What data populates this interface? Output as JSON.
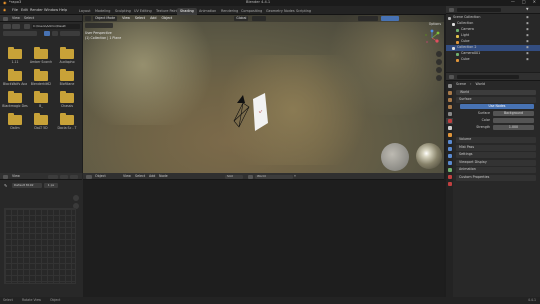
{
  "window": {
    "title": "Blender 4.4.1",
    "app_label": "*rapo3",
    "controls": [
      "—",
      "□",
      "✕"
    ]
  },
  "menu": [
    "File",
    "Edit",
    "Render",
    "Window",
    "Help"
  ],
  "workspaces": [
    "Layout",
    "Modeling",
    "Sculpting",
    "UV Editing",
    "Texture Paint",
    "Shading",
    "Animation",
    "Rendering",
    "Compositing",
    "Geometry Nodes",
    "Scripting"
  ],
  "active_workspace": "Shading",
  "file_browser": {
    "header": [
      "View",
      "Select"
    ],
    "path": "C:\\Users\\Admin\\Deskt",
    "folders": [
      "1.11",
      "Amber Scorch",
      "Audiopho",
      "BlackWolfs Ava",
      "Blenderkit62",
      "Blofiliane",
      "Blackmagic Des",
      "B_",
      "Chassis",
      "Dalim",
      "DaLT 5D",
      "Dacia Sc - T"
    ]
  },
  "viewport": {
    "mode": "Object Mode",
    "menus": [
      "View",
      "Select",
      "Add",
      "Object"
    ],
    "shading": "Global",
    "info_line1": "User Perspective",
    "info_line2": "(1) Collection | 1 Plane",
    "options": "Options"
  },
  "shader_editor": {
    "header_left": [
      "Object",
      "View",
      "Select",
      "Add",
      "Node"
    ],
    "mode": "World",
    "slot": "Slot",
    "world_name": "World",
    "side_header": [
      "View"
    ],
    "image_field": "Default 8192",
    "image_value": "1 px"
  },
  "outliner": {
    "title": "Scene",
    "view_layer": "ViewLayer",
    "items": [
      "Scene Collection",
      "Collection",
      "Camera",
      "Light",
      "Cube",
      "Collection 2",
      "Camera001",
      "Cube"
    ]
  },
  "properties": {
    "scene": "Scene",
    "world_tab": "World",
    "world_name": "World",
    "section_surface": "Surface",
    "use_nodes": "Use Nodes",
    "surface_label": "Surface",
    "surface_value": "Background",
    "color_label": "Color",
    "strength_label": "Strength",
    "strength_value": "1.000",
    "collapsed_sections": [
      "Volume",
      "Mist Pass",
      "Settings",
      "Viewport Display",
      "Animation",
      "Custom Properties"
    ]
  },
  "status": {
    "left": [
      "Select",
      "Rotate View",
      "Object"
    ],
    "right": "4.4.1"
  },
  "colors": {
    "accent": "#4772b3",
    "folder": "#c8a238",
    "selected": "#334d80"
  }
}
